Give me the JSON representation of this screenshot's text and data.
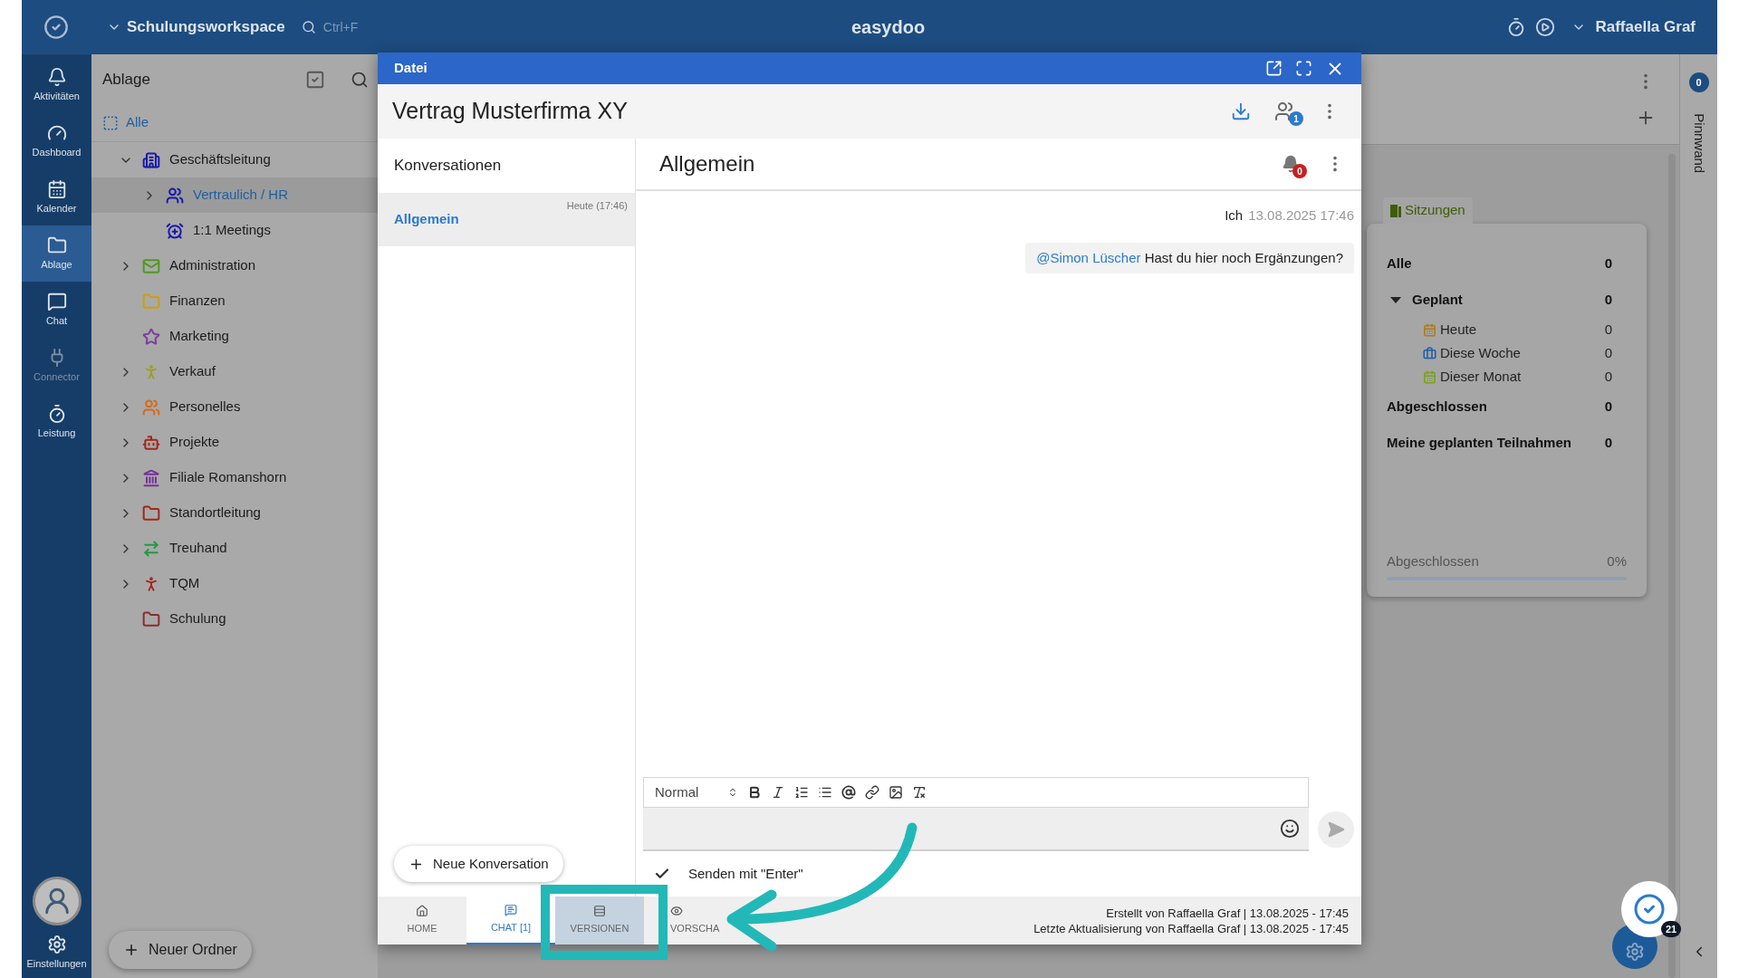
{
  "top_bar": {
    "workspace": "Schulungsworkspace",
    "search_hint": "Ctrl+F",
    "app_name": "easydoo",
    "user": "Raffaella Graf"
  },
  "nav": {
    "items": [
      {
        "kind": "bell",
        "label": "Aktivitäten",
        "selected": false,
        "disabled": false
      },
      {
        "kind": "gauge",
        "label": "Dashboard",
        "selected": false,
        "disabled": false
      },
      {
        "kind": "calendar",
        "label": "Kalender",
        "selected": false,
        "disabled": false
      },
      {
        "kind": "folder",
        "label": "Ablage",
        "selected": true,
        "disabled": false
      },
      {
        "kind": "chat",
        "label": "Chat",
        "selected": false,
        "disabled": false
      },
      {
        "kind": "plug",
        "label": "Connector",
        "selected": false,
        "disabled": true
      },
      {
        "kind": "timer",
        "label": "Leistung",
        "selected": false,
        "disabled": false
      }
    ],
    "settings": "Einstellungen"
  },
  "folders": {
    "title": "Ablage",
    "all": "Alle",
    "new_folder": "Neuer Ordner",
    "tree": [
      {
        "label": "Geschäftsleitung",
        "kind": "building",
        "color": "#1a1aa8",
        "expanded": true,
        "selected": false,
        "children": [
          {
            "label": "Vertraulich / HR",
            "kind": "people",
            "color": "#1a1aa8",
            "expanded": false,
            "selected": true
          },
          {
            "label": "1:1 Meetings",
            "kind": "alarm",
            "color": "#1a1aa8",
            "selected": false
          }
        ]
      },
      {
        "label": "Administration",
        "kind": "mail",
        "color": "#4f9a1e",
        "expanded": false,
        "selected": false
      },
      {
        "label": "Finanzen",
        "kind": "folder",
        "color": "#c9a010",
        "selected": false
      },
      {
        "label": "Marketing",
        "kind": "star",
        "color": "#7f3f9e",
        "selected": false
      },
      {
        "label": "Verkauf",
        "kind": "person",
        "color": "#9aa11e",
        "expanded": false,
        "selected": false
      },
      {
        "label": "Personelles",
        "kind": "group",
        "color": "#d66a1c",
        "expanded": false,
        "selected": false
      },
      {
        "label": "Projekte",
        "kind": "robot",
        "color": "#a1271c",
        "expanded": false,
        "selected": false
      },
      {
        "label": "Filiale Romanshorn",
        "kind": "bank",
        "color": "#7a2f9e",
        "expanded": false,
        "selected": false
      },
      {
        "label": "Standortleitung",
        "kind": "folder",
        "color": "#a1271c",
        "expanded": false,
        "selected": false
      },
      {
        "label": "Treuhand",
        "kind": "arrows",
        "color": "#1f9a3e",
        "expanded": false,
        "selected": false
      },
      {
        "label": "TQM",
        "kind": "person",
        "color": "#a1271c",
        "expanded": false,
        "selected": false
      },
      {
        "label": "Schulung",
        "kind": "folder",
        "color": "#8f2c2c",
        "selected": false
      }
    ]
  },
  "dialog": {
    "title": "Datei",
    "document_title": "Vertrag Musterfirma XY",
    "participants_badge": "1",
    "conversations_heading": "Konversationen",
    "conversations": [
      {
        "name": "Allgemein",
        "time": "Heute (17:46)",
        "selected": true
      }
    ],
    "new_conversation": "Neue Konversation",
    "chat": {
      "title": "Allgemein",
      "notification_badge": "0",
      "messages": [
        {
          "author": "Ich",
          "time": "13.08.2025 17:46",
          "mention": "@Simon Lüscher",
          "text": "Hast du hier noch Ergänzungen?"
        }
      ]
    },
    "editor": {
      "format": "Normal",
      "send_with_enter": {
        "label": "Senden mit \"Enter\"",
        "checked": true
      }
    },
    "tabs": [
      {
        "kind": "home",
        "label": "HOME",
        "selected": false,
        "hovered": false
      },
      {
        "kind": "chat",
        "label": "CHAT [1]",
        "selected": true,
        "hovered": false
      },
      {
        "kind": "versions",
        "label": "VERSIONEN",
        "selected": false,
        "hovered": true
      },
      {
        "kind": "preview",
        "label": "VORSCHA",
        "selected": false,
        "hovered": false
      }
    ],
    "footer": {
      "created": "Erstellt von Raffaella Graf | 13.08.2025 - 17:45",
      "updated": "Letzte Aktualisierung von Raffaella Graf | 13.08.2025 - 17:45"
    }
  },
  "sessions": {
    "title": "Sitzungen",
    "rows": [
      {
        "label": "Alle",
        "count": "0"
      },
      {
        "label": "Geplant",
        "count": "0",
        "expanded": true,
        "children": [
          {
            "label": "Heute",
            "count": "0",
            "kind": "calendar",
            "color": "#b07a10"
          },
          {
            "label": "Diese Woche",
            "count": "0",
            "kind": "briefcase",
            "color": "#1f5fa8"
          },
          {
            "label": "Dieser Monat",
            "count": "0",
            "kind": "calendar",
            "color": "#7aa01e"
          }
        ]
      },
      {
        "label": "Abgeschlossen",
        "count": "0"
      },
      {
        "label": "Meine geplanten Teilnahmen",
        "count": "0"
      }
    ],
    "progress": {
      "label": "Abgeschlossen",
      "reading": "0%",
      "level": 0
    }
  },
  "pinboard": {
    "label": "Pinnwand",
    "badge": "0"
  },
  "tasks_badge": "21"
}
